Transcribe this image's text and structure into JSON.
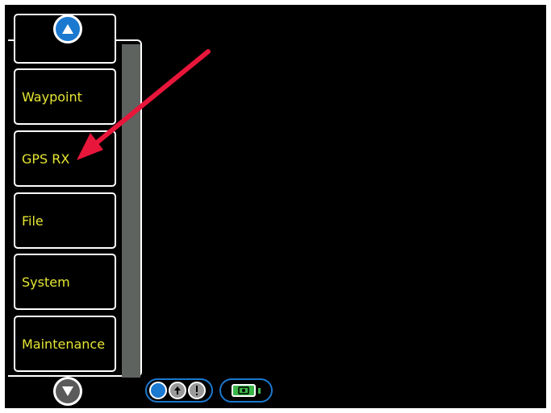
{
  "menu": {
    "items": [
      {
        "label": ""
      },
      {
        "label": "Waypoint"
      },
      {
        "label": "GPS RX"
      },
      {
        "label": "File"
      },
      {
        "label": "System"
      },
      {
        "label": "Maintenance"
      }
    ]
  },
  "scroll": {
    "up_icon": "triangle-up-icon",
    "down_icon": "triangle-down-icon"
  },
  "status": {
    "icons": [
      "status-dot-icon",
      "up-arrow-icon",
      "alert-icon",
      "battery-icon"
    ]
  },
  "annotation": {
    "color": "#e8163a"
  },
  "colors": {
    "label": "#e6e633",
    "accent": "#1b79d0",
    "track": "#5e6360",
    "battery": "#3bb54a"
  }
}
